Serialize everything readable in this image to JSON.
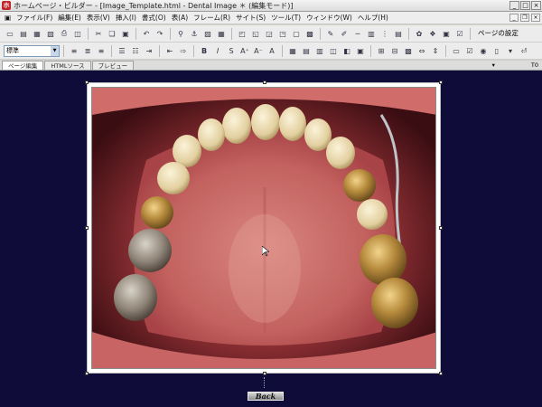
{
  "window": {
    "app_name": "ホームページ・ビルダー",
    "file_name": "Image_Template.html",
    "page_title": "Dental Image",
    "mode": "＊ (編集モード)"
  },
  "menu": [
    "ファイル(F)",
    "編集(E)",
    "表示(V)",
    "挿入(I)",
    "書式(O)",
    "表(A)",
    "フレーム(R)",
    "サイト(S)",
    "ツール(T)",
    "ウィンドウ(W)",
    "ヘルプ(H)"
  ],
  "toolbar": {
    "style_value": "標準",
    "site_settings_label": "ページの設定"
  },
  "tabs": [
    {
      "label": "ページ編集"
    },
    {
      "label": "HTMLソース"
    },
    {
      "label": "プレビュー"
    }
  ],
  "tabbar_right": {
    "zoom": "▾",
    "level": "T0"
  },
  "page": {
    "image_alt": "口腔内写真 上顎咬合面観",
    "back_label": "Back"
  },
  "colors": {
    "canvas_background": "#0f0c3a",
    "title_accent": "#c1262c"
  }
}
